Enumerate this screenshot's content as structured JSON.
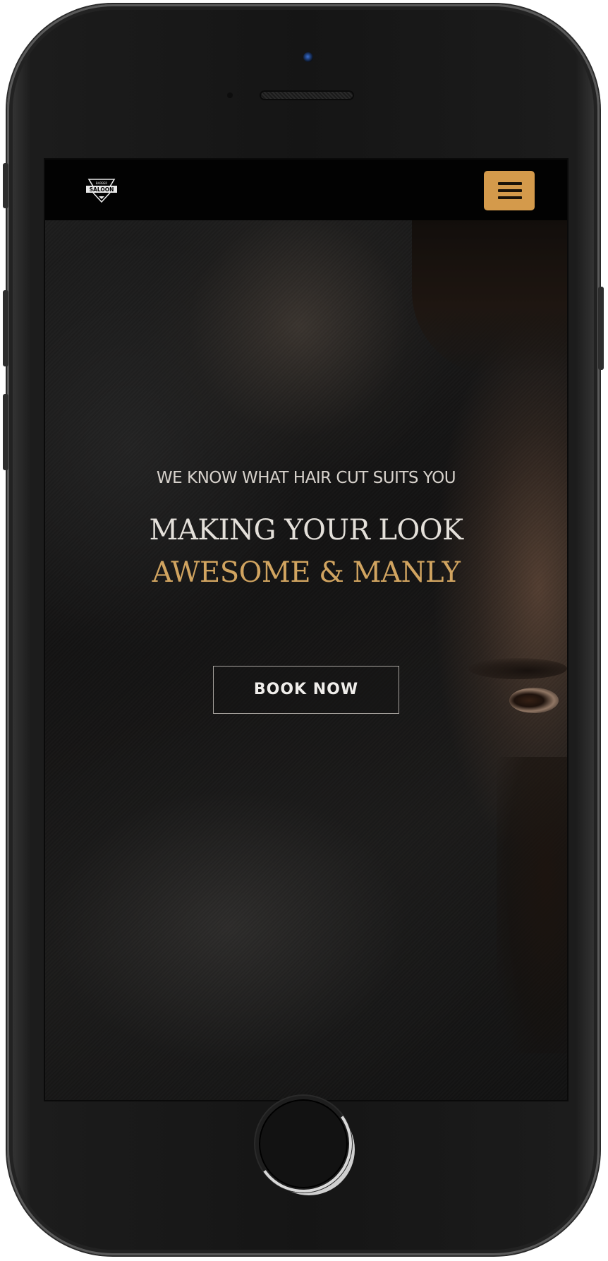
{
  "navbar": {
    "logo_name": "barber-saloon-logo",
    "logo_text_top": "BARBER",
    "logo_text_main": "SALOON",
    "menu_icon": "hamburger-menu-icon",
    "menu_color": "#d49a4b"
  },
  "hero": {
    "subtitle": "WE KNOW WHAT HAIR CUT SUITS YOU",
    "headline_line1": "MAKING YOUR LOOK",
    "headline_line2": "AWESOME & MANLY",
    "headline_accent_color": "#d1a460",
    "cta_label": "BOOK NOW"
  }
}
